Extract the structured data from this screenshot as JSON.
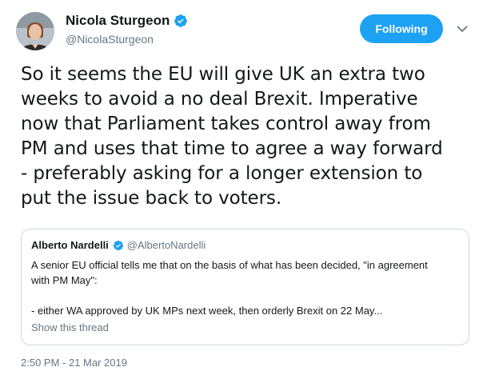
{
  "author": {
    "display_name": "Nicola Sturgeon",
    "handle": "@NicolaSturgeon"
  },
  "follow_button": {
    "label": "Following"
  },
  "tweet": {
    "lines": [
      "So it seems the EU will give UK an extra two",
      "weeks to avoid a no deal Brexit. Imperative",
      "now that Parliament takes control away from",
      "PM and uses that time to agree a way forward",
      "- preferably asking for a longer extension to",
      "put the issue back to voters."
    ],
    "timestamp": "2:50 PM - 21 Mar 2019"
  },
  "quoted_tweet": {
    "display_name": "Alberto Nardelli",
    "handle": "@AlbertoNardelli",
    "lines": [
      "A senior EU official tells me that on the basis of what has been decided, \"in agreement",
      "with PM May\":",
      "",
      "- either WA approved by UK MPs next week, then orderly Brexit on 22 May..."
    ],
    "show_thread": "Show this thread"
  },
  "icons": {
    "verified": "verified-badge-icon",
    "caret": "chevron-down-icon"
  },
  "colors": {
    "accent": "#1da1f2",
    "muted": "#657786",
    "text": "#14171a",
    "border": "#ccd6dd"
  }
}
